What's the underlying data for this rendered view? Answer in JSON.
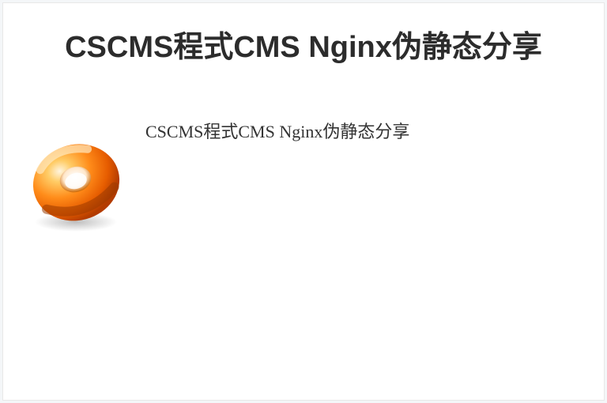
{
  "title": "CSCMS程式CMS Nginx伪静态分享",
  "subtitle": "CSCMS程式CMS Nginx伪静态分享",
  "icon_name": "orange-torus-icon"
}
